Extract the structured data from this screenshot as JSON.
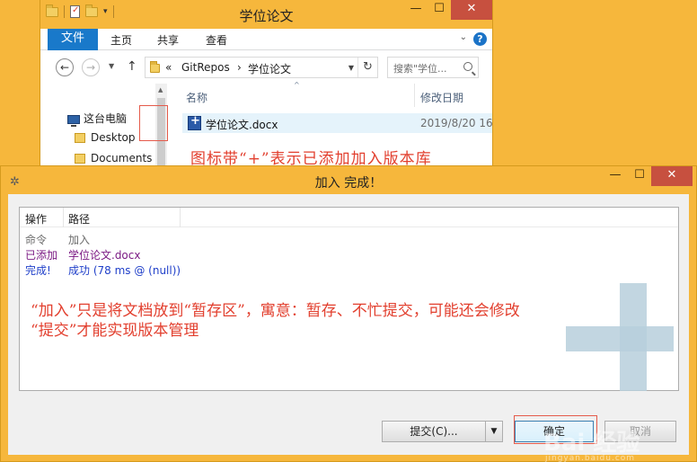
{
  "explorer": {
    "title": "学位论文",
    "ribbon_tabs": [
      "文件",
      "主页",
      "共享",
      "查看"
    ],
    "help_label": "?",
    "breadcrumb": {
      "chevrons": "«",
      "parts": [
        "GitRepos",
        "学位论文"
      ],
      "separator": "›"
    },
    "search_placeholder": "搜索\"学位...",
    "nav_items": [
      "这台电脑",
      "Desktop",
      "Documents"
    ],
    "columns": [
      "名称",
      "修改日期"
    ],
    "file": {
      "name": "学位论文.docx",
      "date": "2019/8/20 16"
    }
  },
  "annotations": {
    "icon_note": "图标带“+”表示已添加加入版本库",
    "stage_note_line1": "“加入”只是将文档放到“暂存区”，寓意：暂存、不忙提交，可能还会修改",
    "stage_note_line2": "“提交”才能实现版本管理"
  },
  "dialog": {
    "title": "加入 完成！",
    "columns": [
      "操作",
      "路径"
    ],
    "rows": [
      {
        "action": "命令",
        "path": "加入"
      },
      {
        "action": "已添加",
        "path": "学位论文.docx"
      },
      {
        "action": "完成!",
        "path": "成功 (78 ms @ (null))"
      }
    ],
    "buttons": {
      "commit": "提交(C)...",
      "ok": "确定",
      "cancel": "取消"
    }
  },
  "watermark": {
    "text": "Bai 经验",
    "sub": "jingyan.baidu.com"
  },
  "colors": {
    "explorer_accent": "#1979ca",
    "titlebar": "#f6b73c",
    "annotation": "#e23f2e",
    "added": "#7b1a84",
    "success": "#1f3fc9"
  }
}
